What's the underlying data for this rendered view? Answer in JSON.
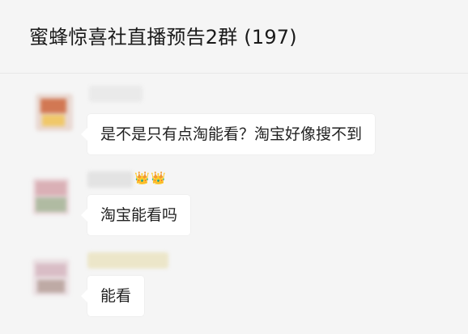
{
  "header": {
    "title": "蜜蜂惊喜社直播预告2群 (197)"
  },
  "messages": [
    {
      "text": "是不是只有点淘能看？淘宝好像搜不到",
      "sender_badges": []
    },
    {
      "text": "淘宝能看吗",
      "sender_badges": [
        "crown-icon",
        "crown-icon"
      ]
    },
    {
      "text": "能看",
      "sender_badges": []
    }
  ]
}
